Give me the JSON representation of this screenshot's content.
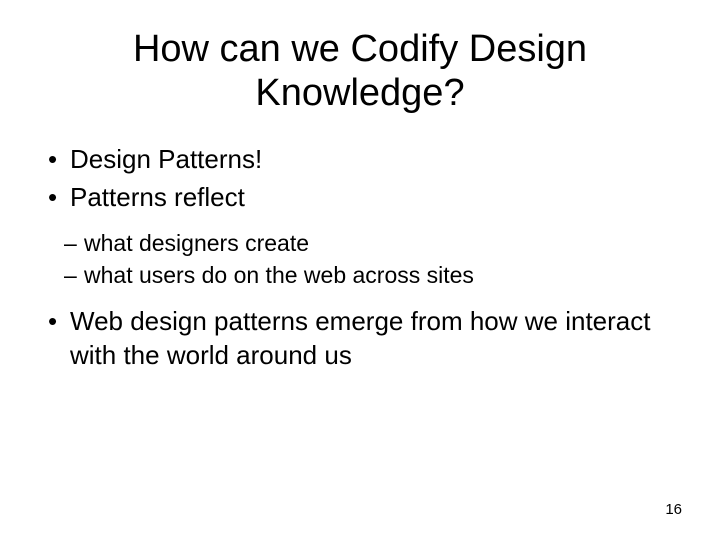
{
  "slide": {
    "title": "How can we Codify Design Knowledge?",
    "bullets": [
      "Design Patterns!",
      "Patterns reflect"
    ],
    "subbullets": [
      "what designers create",
      "what users do on the web across sites"
    ],
    "bullet3": "Web design patterns emerge from how we interact with the world around us",
    "page_number": "16"
  }
}
